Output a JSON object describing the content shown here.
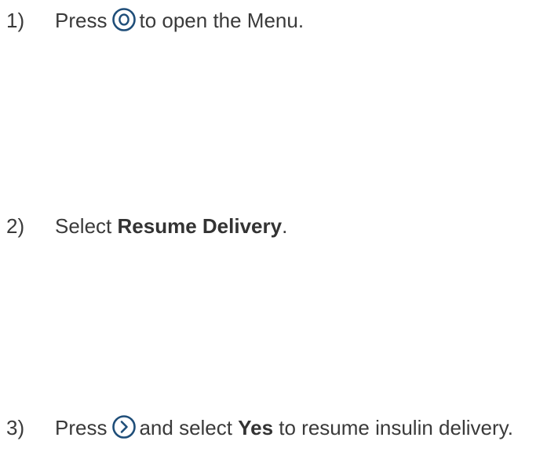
{
  "steps": [
    {
      "number": "1)",
      "before": "Press",
      "icon": "menu-circle-o-icon",
      "after": "to open the Menu."
    },
    {
      "number": "2)",
      "before": "Select ",
      "bold": "Resume Delivery",
      "after": "."
    },
    {
      "number": "3)",
      "before": "Press",
      "icon": "chevron-right-circle-icon",
      "middle": "and select ",
      "bold": "Yes",
      "after": " to resume insulin delivery."
    }
  ],
  "colors": {
    "text": "#3a3a3a",
    "icon": "#1f4e79"
  }
}
